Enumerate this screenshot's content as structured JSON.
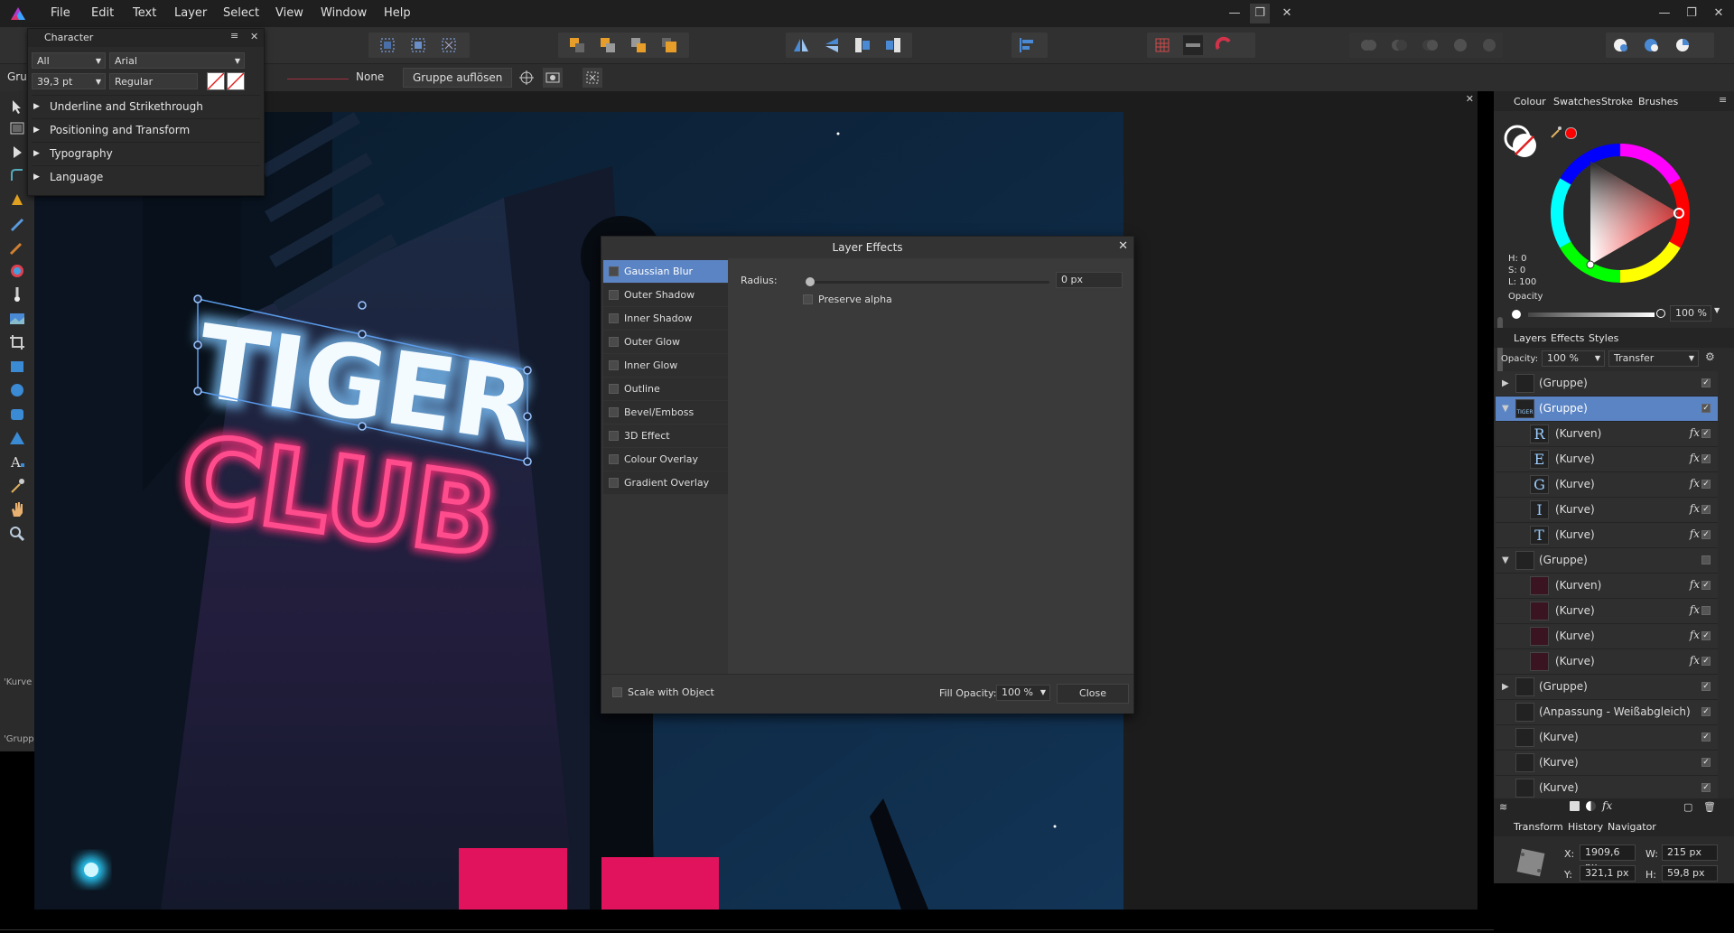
{
  "menu": [
    "File",
    "Edit",
    "Text",
    "Layer",
    "Select",
    "View",
    "Window",
    "Help"
  ],
  "contextbar": {
    "gru_label": "Gru",
    "none_label": "None",
    "ungroup_label": "Gruppe auflösen"
  },
  "character_panel": {
    "title": "Character",
    "collection": "All",
    "font": "Arial",
    "size": "39,3 pt",
    "style": "Regular",
    "sections": [
      "Underline and Strikethrough",
      "Positioning and Transform",
      "Typography",
      "Language"
    ]
  },
  "canvas_text": {
    "line1": "TIGER",
    "line2": "CLUB"
  },
  "left_labels": {
    "kurve": "'Kurve",
    "grupp": "'Grupp"
  },
  "layer_effects": {
    "title": "Layer Effects",
    "effects": [
      "Gaussian Blur",
      "Outer Shadow",
      "Inner Shadow",
      "Outer Glow",
      "Inner Glow",
      "Outline",
      "Bevel/Emboss",
      "3D Effect",
      "Colour Overlay",
      "Gradient Overlay"
    ],
    "selected": "Gaussian Blur",
    "radius_label": "Radius:",
    "radius_value": "0 px",
    "radius_fraction": 0.0,
    "preserve_alpha": "Preserve alpha",
    "scale_with_object": "Scale with Object",
    "fill_opacity_label": "Fill Opacity:",
    "fill_opacity_value": "100 %",
    "close_label": "Close"
  },
  "colour_panel": {
    "tabs": [
      "Colour",
      "Swatches",
      "Stroke",
      "Brushes"
    ],
    "h": "H: 0",
    "s": "S: 0",
    "l": "L: 100",
    "opacity_label": "Opacity",
    "opacity_value": "100 %"
  },
  "layers_panel": {
    "tabs": [
      "Layers",
      "Effects",
      "Styles"
    ],
    "opacity_label": "Opacity:",
    "opacity_value": "100 %",
    "blend_mode": "Transfer",
    "rows": [
      {
        "name": "(Gruppe)",
        "expand": "right",
        "indent": 0,
        "thumb": "",
        "fx": false,
        "checked": true,
        "selected": false
      },
      {
        "name": "(Gruppe)",
        "expand": "down",
        "indent": 0,
        "thumb": "TIGER",
        "fx": false,
        "checked": true,
        "selected": true
      },
      {
        "name": "(Kurven)",
        "expand": "",
        "indent": 1,
        "thumb": "R",
        "fx": true,
        "checked": true,
        "selected": false
      },
      {
        "name": "(Kurve)",
        "expand": "",
        "indent": 1,
        "thumb": "E",
        "fx": true,
        "checked": true,
        "selected": false
      },
      {
        "name": "(Kurve)",
        "expand": "",
        "indent": 1,
        "thumb": "G",
        "fx": true,
        "checked": true,
        "selected": false
      },
      {
        "name": "(Kurve)",
        "expand": "",
        "indent": 1,
        "thumb": "I",
        "fx": true,
        "checked": true,
        "selected": false
      },
      {
        "name": "(Kurve)",
        "expand": "",
        "indent": 1,
        "thumb": "T",
        "fx": true,
        "checked": true,
        "selected": false
      },
      {
        "name": "(Gruppe)",
        "expand": "down",
        "indent": 0,
        "thumb": "",
        "fx": false,
        "checked": false,
        "selected": false
      },
      {
        "name": "(Kurven)",
        "expand": "",
        "indent": 1,
        "thumb": "",
        "fx": true,
        "checked": true,
        "selected": false
      },
      {
        "name": "(Kurve)",
        "expand": "",
        "indent": 1,
        "thumb": "",
        "fx": true,
        "checked": false,
        "selected": false
      },
      {
        "name": "(Kurve)",
        "expand": "",
        "indent": 1,
        "thumb": "",
        "fx": true,
        "checked": true,
        "selected": false
      },
      {
        "name": "(Kurve)",
        "expand": "",
        "indent": 1,
        "thumb": "",
        "fx": true,
        "checked": true,
        "selected": false
      },
      {
        "name": "(Gruppe)",
        "expand": "right",
        "indent": 0,
        "thumb": "",
        "fx": false,
        "checked": true,
        "selected": false
      },
      {
        "name": "(Anpassung - Weißabgleich)",
        "expand": "",
        "indent": 0,
        "thumb": "",
        "fx": false,
        "checked": true,
        "selected": false
      },
      {
        "name": "(Kurve)",
        "expand": "",
        "indent": 0,
        "thumb": "",
        "fx": false,
        "checked": true,
        "selected": false
      },
      {
        "name": "(Kurve)",
        "expand": "",
        "indent": 0,
        "thumb": "",
        "fx": false,
        "checked": true,
        "selected": false
      },
      {
        "name": "(Kurve)",
        "expand": "",
        "indent": 0,
        "thumb": "",
        "fx": false,
        "checked": true,
        "selected": false
      }
    ]
  },
  "transform_panel": {
    "tabs": [
      "Transform",
      "History",
      "Navigator"
    ],
    "x_label": "X:",
    "x_value": "1909,6 px",
    "y_label": "Y:",
    "y_value": "321,1 px",
    "w_label": "W:",
    "w_value": "215 px",
    "h_label": "H:",
    "h_value": "59,8 px"
  },
  "colors": {
    "accent": "#5b84c4",
    "neon_blue": "#a9dcff",
    "neon_pink": "#ff2f7a",
    "wheel_red": "#ff0000"
  }
}
